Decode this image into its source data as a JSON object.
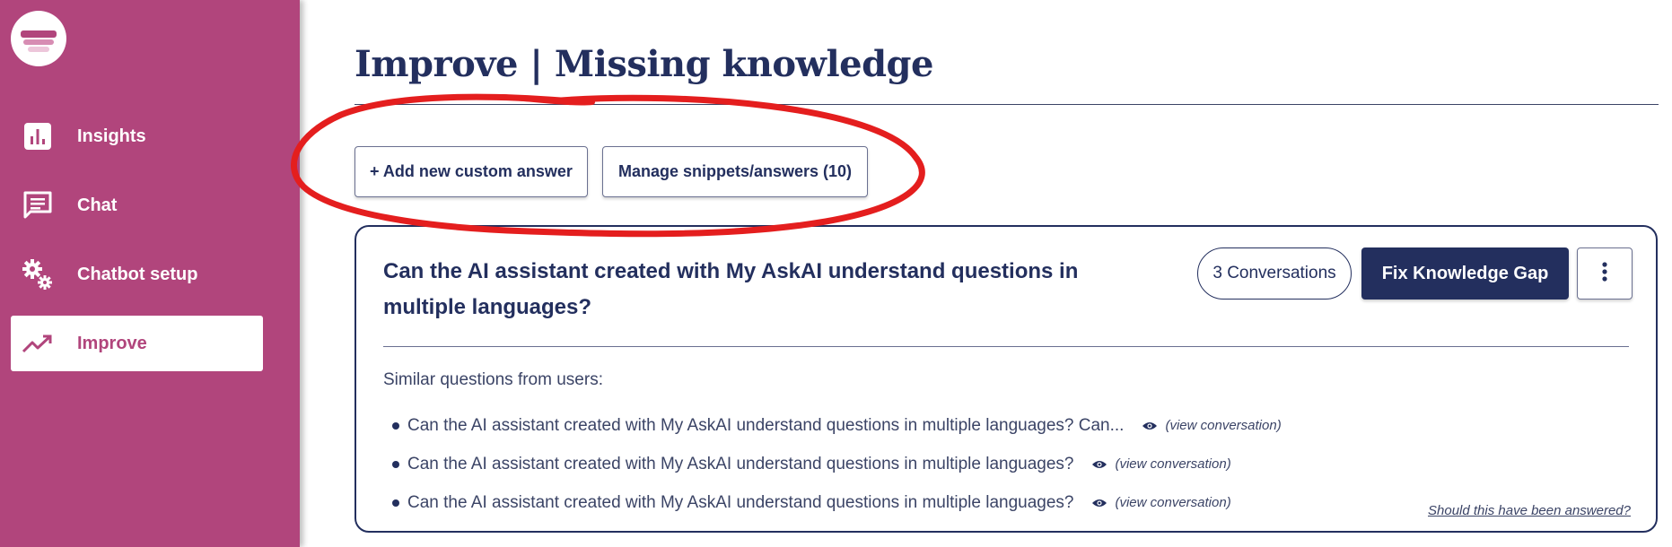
{
  "sidebar": {
    "items": [
      {
        "label": "Insights",
        "icon": "bar-chart-icon"
      },
      {
        "label": "Chat",
        "icon": "chat-icon"
      },
      {
        "label": "Chatbot setup",
        "icon": "gears-icon"
      },
      {
        "label": "Improve",
        "icon": "trending-up-icon",
        "active": true
      }
    ]
  },
  "header": {
    "title": "Improve | Missing knowledge"
  },
  "actions": {
    "add_label": "+ Add new custom answer",
    "manage_label": "Manage snippets/answers (10)"
  },
  "card": {
    "question": "Can the AI assistant created with My AskAI understand questions in multiple languages?",
    "conversations_label": "3 Conversations",
    "fix_label": "Fix Knowledge Gap",
    "similar_heading": "Similar questions from users:",
    "similar": [
      {
        "text": "Can the AI assistant created with My AskAI understand questions in multiple languages? Can...",
        "link": "(view conversation)"
      },
      {
        "text": "Can the AI assistant created with My AskAI understand questions in multiple languages?",
        "link": "(view conversation)"
      },
      {
        "text": "Can the AI assistant created with My AskAI understand questions in multiple languages?",
        "link": "(view conversation)"
      }
    ],
    "feedback_link": "Should this have been answered?"
  },
  "colors": {
    "sidebar": "#b1457c",
    "navy": "#232f5e",
    "annotation": "#e41e1e"
  }
}
